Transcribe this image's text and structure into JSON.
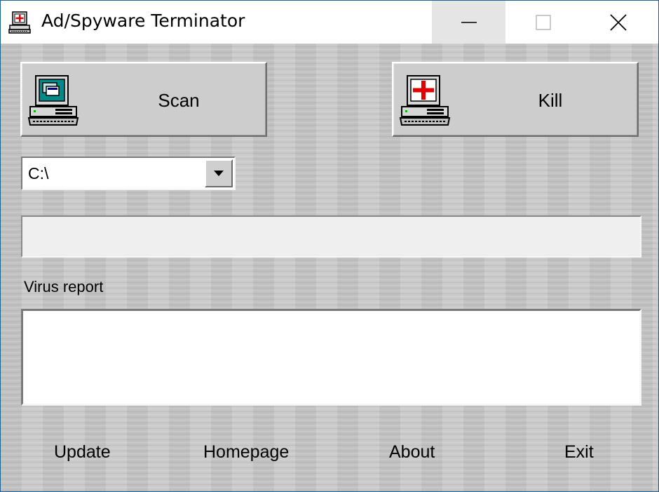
{
  "window": {
    "title": "Ad/Spyware Terminator",
    "icon": "computer-cross-icon",
    "controls": [
      "minimize-icon",
      "maximize-icon",
      "close-icon"
    ]
  },
  "actions": {
    "scan": {
      "label": "Scan",
      "icon": "computer-scan-icon"
    },
    "kill": {
      "label": "Kill",
      "icon": "computer-red-cross-icon"
    }
  },
  "drive_select": {
    "value": "C:\\",
    "icon": "chevron-down-icon"
  },
  "progress": {
    "value_percent": 0
  },
  "report": {
    "label": "Virus report",
    "content": ""
  },
  "footer": {
    "update": "Update",
    "homepage": "Homepage",
    "about": "About",
    "exit": "Exit"
  },
  "colors": {
    "background": "#c8c8c8",
    "titlebar": "#ffffff",
    "minimize_hover": "#e5e5e5",
    "progress_fill": "#2a62c9",
    "cross_red": "#e00000"
  }
}
